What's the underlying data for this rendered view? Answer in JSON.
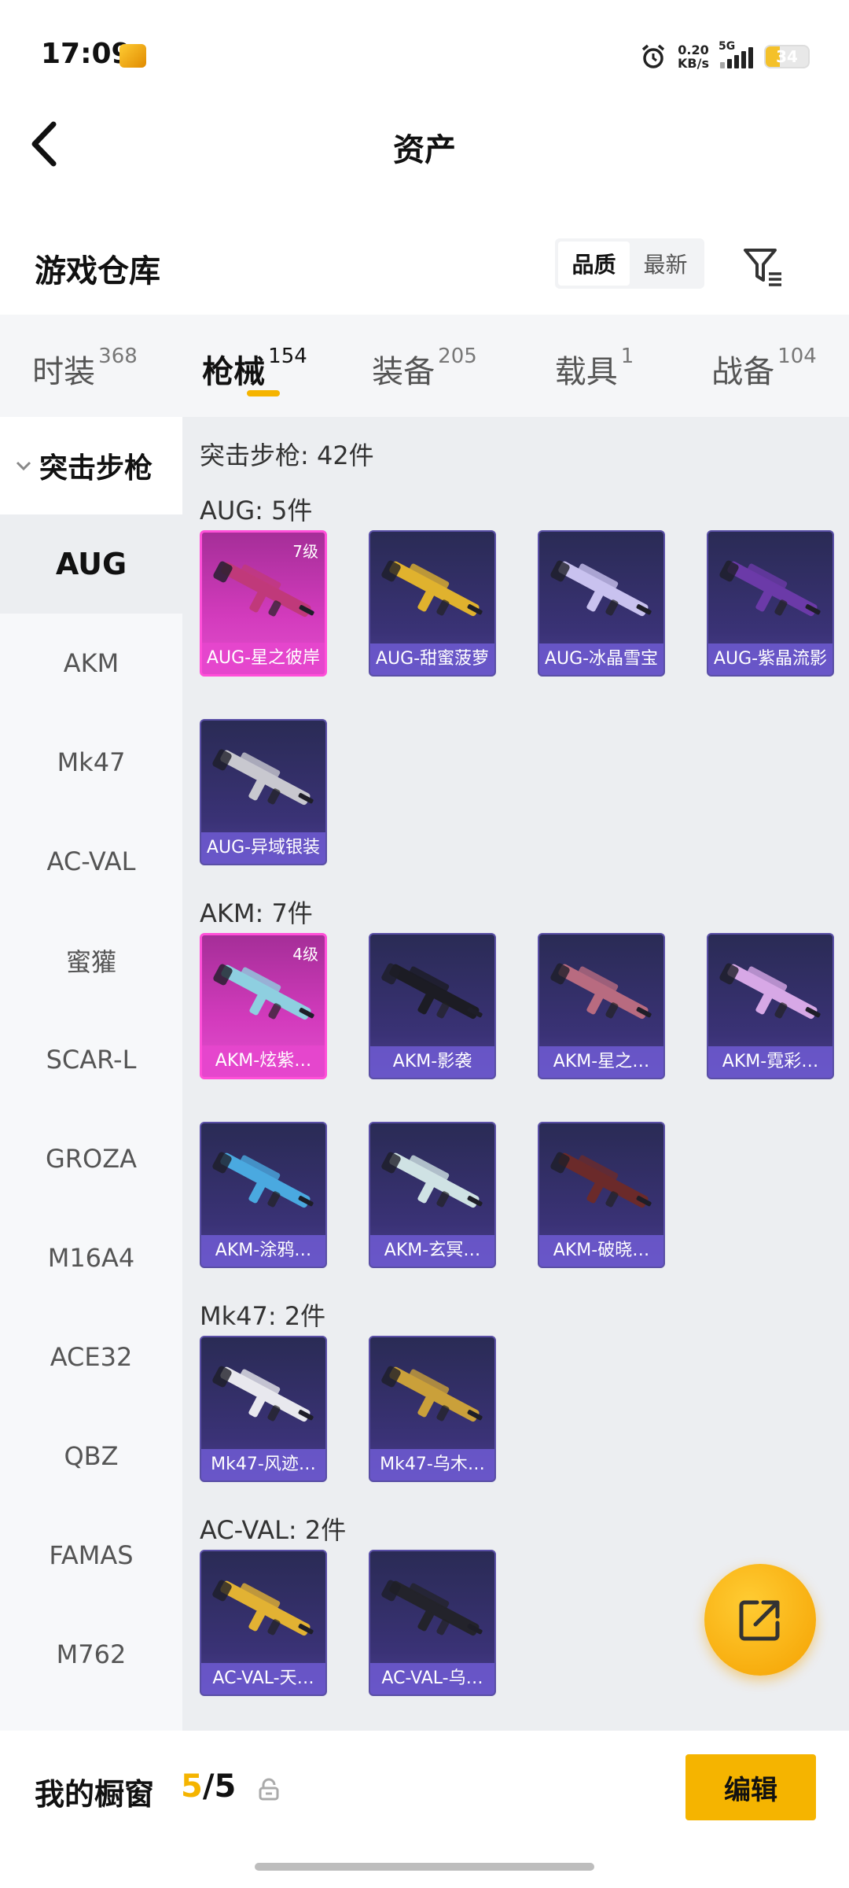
{
  "status_bar": {
    "time": "17:09",
    "net_speed_value": "0.20",
    "net_speed_unit": "KB/s",
    "network": "5G",
    "battery": "34",
    "battery_level": 0.34
  },
  "header": {
    "title": "资产"
  },
  "section": {
    "title": "游戏仓库",
    "sort_options": [
      "品质",
      "最新"
    ],
    "active_sort": "品质"
  },
  "tabs": [
    {
      "label": "时装",
      "count": "368"
    },
    {
      "label": "枪械",
      "count": "154",
      "active": true
    },
    {
      "label": "装备",
      "count": "205"
    },
    {
      "label": "载具",
      "count": "1"
    },
    {
      "label": "战备",
      "count": "104"
    }
  ],
  "sidebar": {
    "category": "突击步枪",
    "items": [
      "AUG",
      "AKM",
      "Mk47",
      "AC-VAL",
      "蜜獾",
      "SCAR-L",
      "GROZA",
      "M16A4",
      "ACE32",
      "QBZ",
      "FAMAS",
      "M762"
    ],
    "active": "AUG"
  },
  "main": {
    "category_total": "突击步枪: 42件",
    "groups": [
      {
        "label": "AUG: 5件",
        "items": [
          {
            "name": "AUG-星之彼岸",
            "level": "7级",
            "rare": true,
            "gun_color": "#c0397a"
          },
          {
            "name": "AUG-甜蜜菠萝",
            "gun_color": "#e0b22e"
          },
          {
            "name": "AUG-冰晶雪宝",
            "gun_color": "#c9c2ef"
          },
          {
            "name": "AUG-紫晶流影",
            "gun_color": "#6b3aa8"
          },
          {
            "name": "AUG-异域银装",
            "gun_color": "#c8c8cf"
          }
        ]
      },
      {
        "label": "AKM: 7件",
        "items": [
          {
            "name": "AKM-炫紫…",
            "level": "4级",
            "rare": true,
            "gun_color": "#8ecfe0"
          },
          {
            "name": "AKM-影袭",
            "gun_color": "#1c1c24"
          },
          {
            "name": "AKM-星之…",
            "gun_color": "#b86b80"
          },
          {
            "name": "AKM-霓彩…",
            "gun_color": "#d7a8e6"
          },
          {
            "name": "AKM-涂鸦…",
            "gun_color": "#4aa9e0"
          },
          {
            "name": "AKM-玄冥…",
            "gun_color": "#cfe2e4"
          },
          {
            "name": "AKM-破晓…",
            "gun_color": "#6b2a2a"
          }
        ]
      },
      {
        "label": "Mk47: 2件",
        "items": [
          {
            "name": "Mk47-风迹…",
            "gun_color": "#e8e8ee"
          },
          {
            "name": "Mk47-乌木…",
            "gun_color": "#caa03a"
          }
        ]
      },
      {
        "label": "AC-VAL: 2件",
        "items": [
          {
            "name": "AC-VAL-天…",
            "gun_color": "#e2b233"
          },
          {
            "name": "AC-VAL-乌…",
            "gun_color": "#23232b"
          }
        ]
      }
    ]
  },
  "footer": {
    "showcase_label": "我的橱窗",
    "showcase_current": "5",
    "showcase_total": "/5",
    "edit_label": "编辑"
  },
  "colors": {
    "accent": "#f5b400",
    "rare_card": "#e24fcd",
    "card_bg": "#2f2d66"
  },
  "icons": [
    "back-icon",
    "filter-icon",
    "alarm-icon",
    "lock-icon",
    "share-icon",
    "chevron-down-icon"
  ]
}
